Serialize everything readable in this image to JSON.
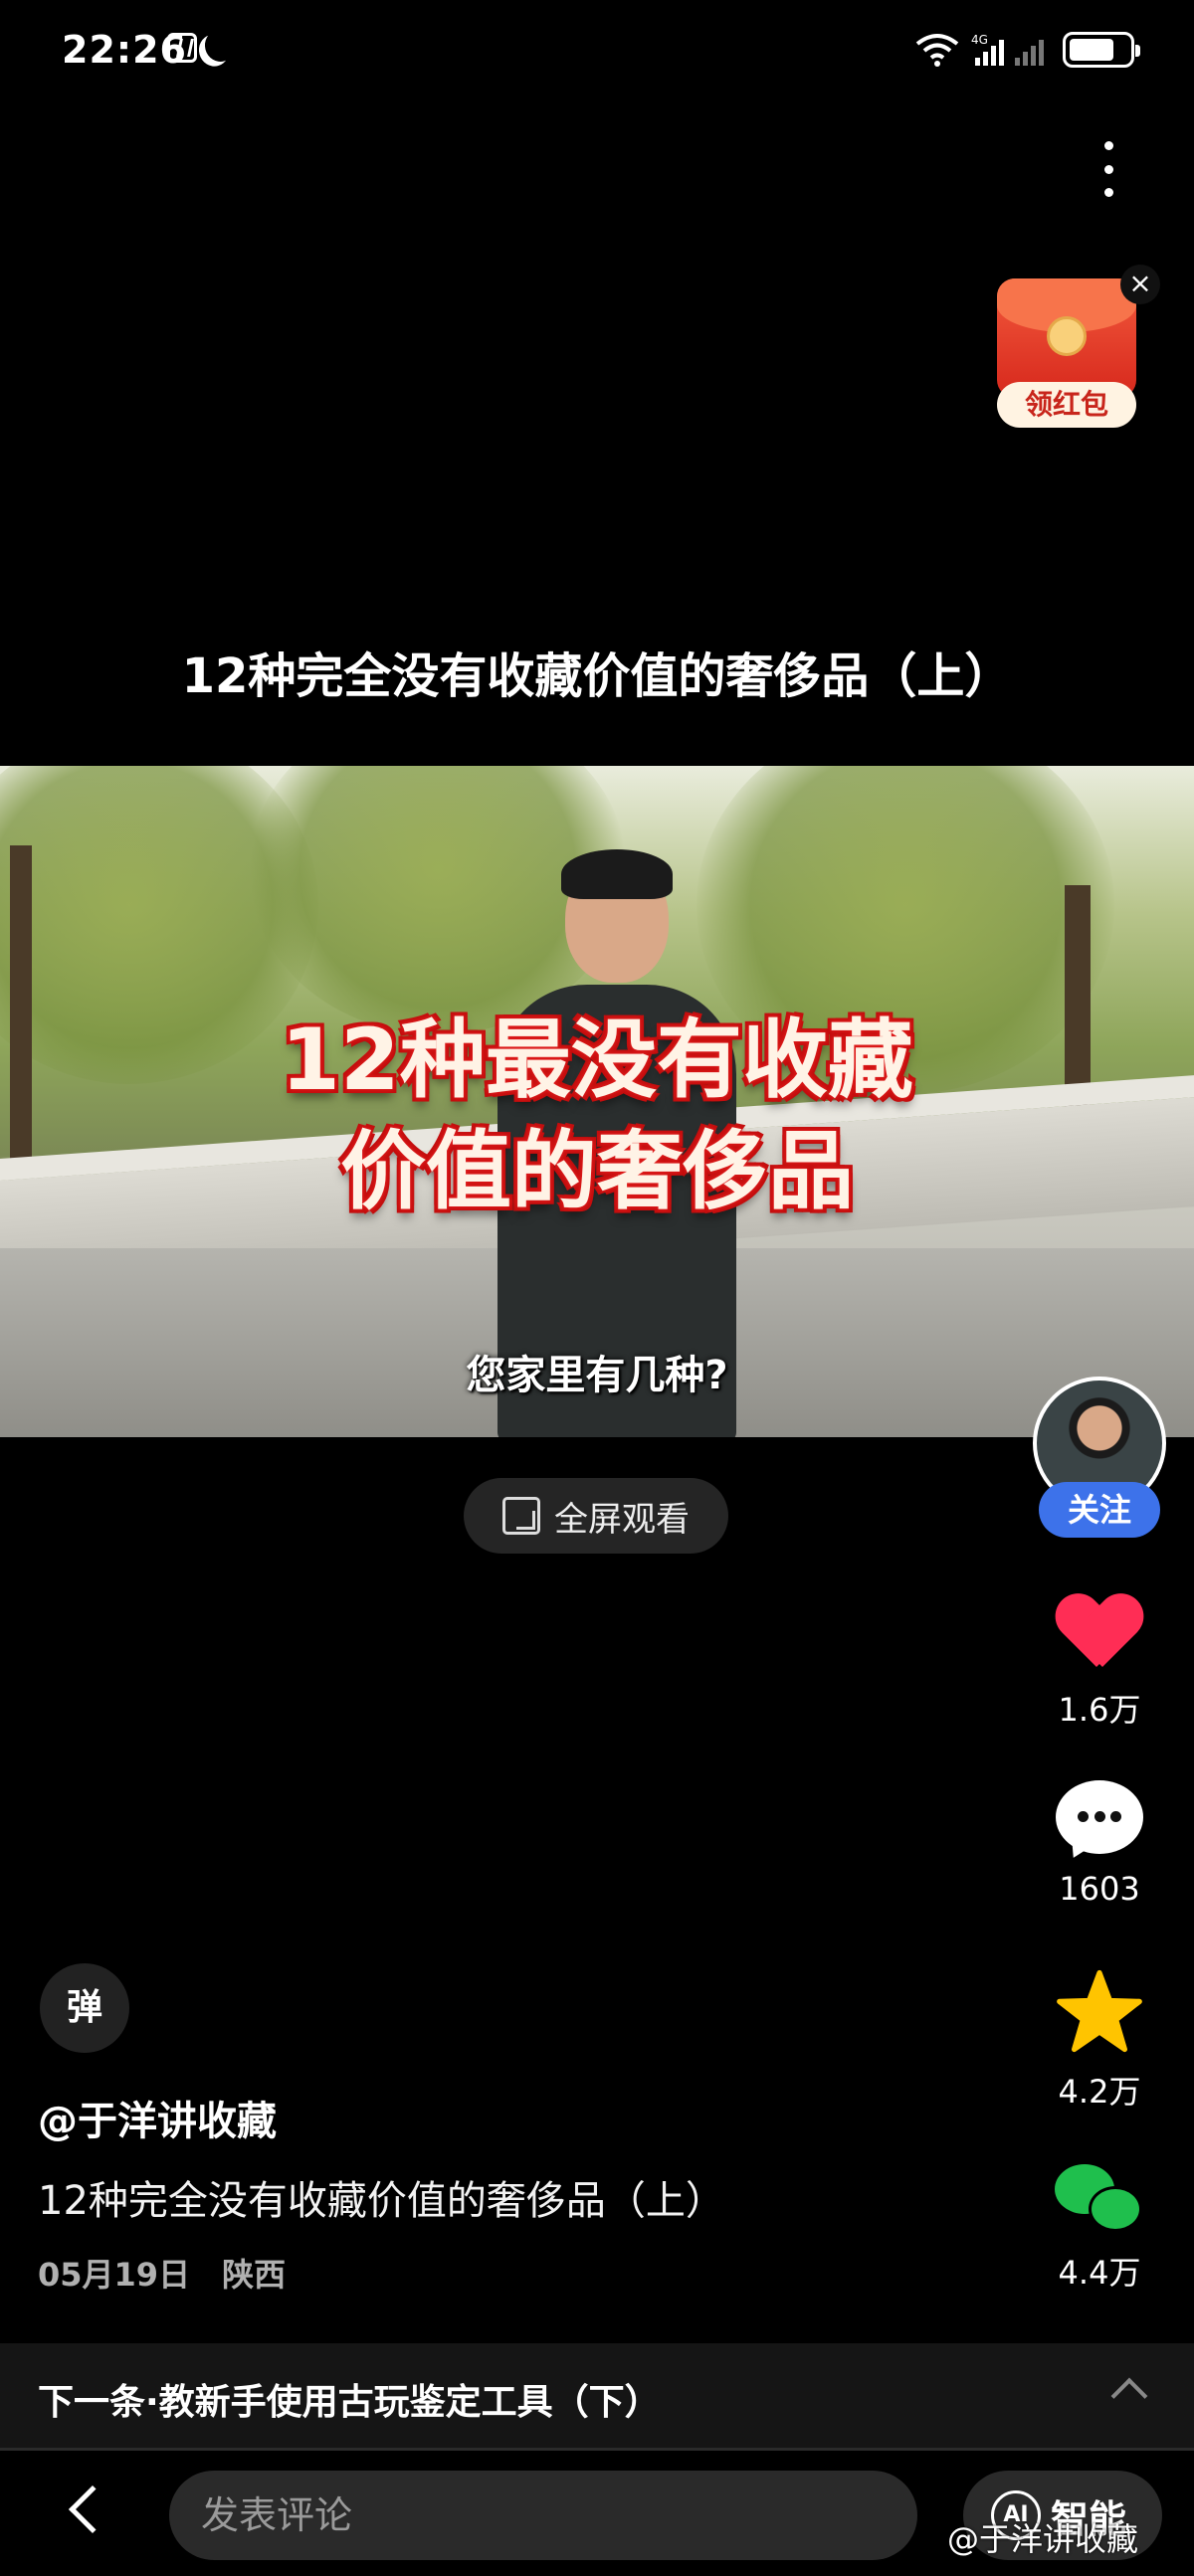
{
  "status_bar": {
    "time": "22:26",
    "network": "4G"
  },
  "envelope": {
    "label": "领红包",
    "close": "×"
  },
  "video": {
    "heading": "12种完全没有收藏价值的奢侈品（上）",
    "banner_line1": "12种最没有收藏",
    "banner_line2": "价值的奢侈品",
    "subtitle": "您家里有几种?"
  },
  "fullscreen": {
    "label": "全屏观看"
  },
  "author": {
    "follow_label": "关注",
    "name": "@于洋讲收藏"
  },
  "actions": {
    "likes": "1.6万",
    "comments": "1603",
    "favorites": "4.2万",
    "shares": "4.4万"
  },
  "danmu": {
    "label": "弹"
  },
  "post": {
    "description": "12种完全没有收藏价值的奢侈品（上）",
    "date": "05月19日",
    "location": "陕西"
  },
  "next": {
    "label": "下一条·教新手使用古玩鉴定工具（下）"
  },
  "bottom": {
    "comment_placeholder": "发表评论",
    "ai_label": "智能",
    "ai_icon_text": "AI",
    "watermark": "@于洋讲收藏"
  },
  "colors": {
    "like": "#ff2d55",
    "favorite": "#ffc400",
    "share": "#1fbf4d",
    "follow": "#3d72ea"
  }
}
